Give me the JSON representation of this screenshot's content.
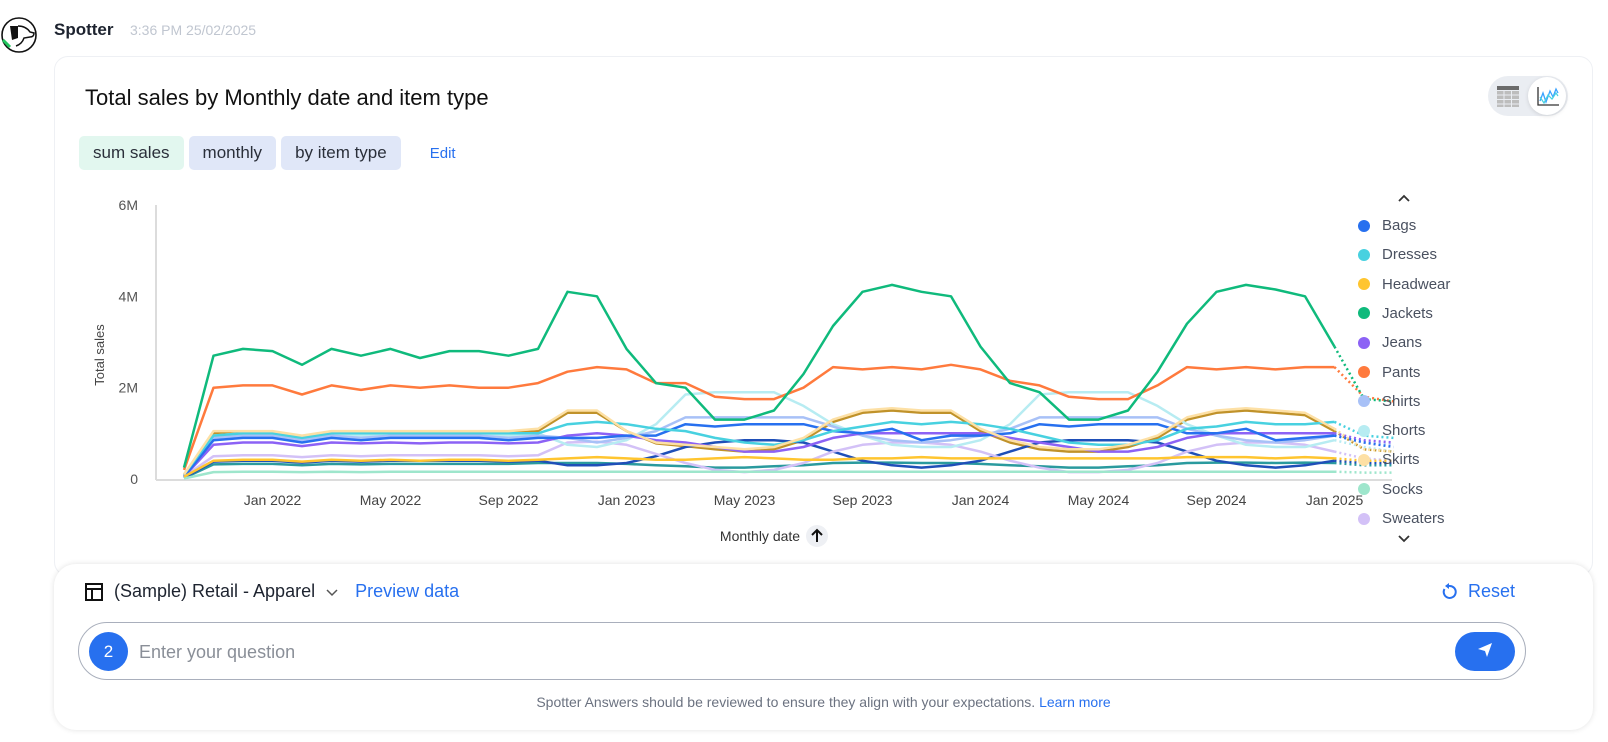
{
  "header": {
    "sender": "Spotter",
    "timestamp": "3:36 PM 25/02/2025",
    "avatar_icon": "spotter-dog-logo-icon"
  },
  "answer": {
    "title": "Total sales by Monthly date and item type",
    "chips": [
      {
        "label": "sum sales",
        "color": "#e2f7ef"
      },
      {
        "label": "monthly",
        "color": "#e0e7f8"
      },
      {
        "label": "by item type",
        "color": "#e0e7f8"
      }
    ],
    "edit_label": "Edit",
    "view_toggle": {
      "options": [
        "table-view-icon",
        "chart-view-icon"
      ],
      "selected": "chart-view-icon"
    },
    "legend_scroll_up_icon": "chevron-up-icon",
    "legend_scroll_down_icon": "chevron-down-icon",
    "sort_icon": "arrow-up-icon"
  },
  "chart_data": {
    "type": "line",
    "title": "Total sales by Monthly date and item type",
    "xlabel": "Monthly date",
    "ylabel": "Total sales",
    "ylim": [
      0,
      6000000
    ],
    "yticks": [
      "0",
      "2M",
      "4M",
      "6M"
    ],
    "ytick_values": [
      0,
      2000000,
      4000000,
      6000000
    ],
    "xticks": [
      "Jan 2022",
      "May 2022",
      "Sep 2022",
      "Jan 2023",
      "May 2023",
      "Sep 2023",
      "Jan 2024",
      "May 2024",
      "Sep 2024",
      "Jan 2025"
    ],
    "xtick_index": [
      3,
      7,
      11,
      15,
      19,
      23,
      27,
      31,
      35,
      39
    ],
    "x": [
      "Oct 2021",
      "Nov 2021",
      "Dec 2021",
      "Jan 2022",
      "Feb 2022",
      "Mar 2022",
      "Apr 2022",
      "May 2022",
      "Jun 2022",
      "Jul 2022",
      "Aug 2022",
      "Sep 2022",
      "Oct 2022",
      "Nov 2022",
      "Dec 2022",
      "Jan 2023",
      "Feb 2023",
      "Mar 2023",
      "Apr 2023",
      "May 2023",
      "Jun 2023",
      "Jul 2023",
      "Aug 2023",
      "Sep 2023",
      "Oct 2023",
      "Nov 2023",
      "Dec 2023",
      "Jan 2024",
      "Feb 2024",
      "Mar 2024",
      "Apr 2024",
      "May 2024",
      "Jun 2024",
      "Jul 2024",
      "Aug 2024",
      "Sep 2024",
      "Oct 2024",
      "Nov 2024",
      "Dec 2024",
      "Jan 2025",
      "Feb 2025",
      "Mar 2025"
    ],
    "partial_from_index": 40,
    "legend_position": "right",
    "grid": false,
    "series": [
      {
        "name": "Jackets",
        "color": "#0fba7c",
        "in_legend": true,
        "values": [
          0.25,
          2.7,
          2.85,
          2.8,
          2.5,
          2.85,
          2.7,
          2.85,
          2.65,
          2.8,
          2.8,
          2.7,
          2.85,
          4.1,
          4.0,
          2.85,
          2.1,
          2.0,
          1.3,
          1.3,
          1.5,
          2.3,
          3.35,
          4.1,
          4.25,
          4.1,
          4.0,
          2.9,
          2.1,
          1.9,
          1.3,
          1.3,
          1.5,
          2.35,
          3.4,
          4.1,
          4.25,
          4.15,
          4.0,
          2.9,
          1.75,
          1.7
        ]
      },
      {
        "name": "Pants",
        "color": "#ff7a3d",
        "in_legend": true,
        "values": [
          0.2,
          2.0,
          2.05,
          2.05,
          1.85,
          2.05,
          1.95,
          2.05,
          2.0,
          2.05,
          2.0,
          2.0,
          2.1,
          2.35,
          2.45,
          2.4,
          2.1,
          2.1,
          1.8,
          1.75,
          1.75,
          2.0,
          2.45,
          2.4,
          2.45,
          2.4,
          2.5,
          2.4,
          2.15,
          2.05,
          1.8,
          1.75,
          1.75,
          2.05,
          2.45,
          2.4,
          2.45,
          2.4,
          2.45,
          2.45,
          1.8,
          1.7
        ]
      },
      {
        "name": "Skirts",
        "color": "#fde0a5",
        "in_legend": true,
        "values": [
          0.1,
          1.05,
          1.05,
          1.05,
          0.95,
          1.05,
          1.05,
          1.05,
          1.05,
          1.05,
          1.05,
          1.05,
          1.1,
          1.5,
          1.5,
          1.05,
          0.8,
          0.75,
          0.7,
          0.65,
          0.7,
          0.9,
          1.3,
          1.5,
          1.55,
          1.5,
          1.5,
          1.1,
          0.85,
          0.7,
          0.65,
          0.65,
          0.75,
          0.95,
          1.35,
          1.5,
          1.55,
          1.5,
          1.45,
          1.1,
          0.65,
          0.6
        ]
      },
      {
        "name": "Headwear",
        "color": "#ffc52f",
        "in_legend": true,
        "values": [
          0.05,
          0.4,
          0.42,
          0.42,
          0.38,
          0.42,
          0.4,
          0.42,
          0.4,
          0.42,
          0.42,
          0.4,
          0.42,
          0.45,
          0.48,
          0.45,
          0.42,
          0.42,
          0.45,
          0.48,
          0.45,
          0.42,
          0.42,
          0.45,
          0.45,
          0.48,
          0.45,
          0.45,
          0.45,
          0.45,
          0.45,
          0.45,
          0.45,
          0.45,
          0.48,
          0.48,
          0.48,
          0.45,
          0.48,
          0.45,
          0.4,
          0.4
        ]
      },
      {
        "name": "Dresses",
        "color": "#48d1e0",
        "in_legend": true,
        "values": [
          0.1,
          0.95,
          1.0,
          1.0,
          0.9,
          1.0,
          1.0,
          1.0,
          1.0,
          1.0,
          1.0,
          1.0,
          1.0,
          1.2,
          1.25,
          1.2,
          1.1,
          1.05,
          0.9,
          0.8,
          0.75,
          0.85,
          1.05,
          1.15,
          1.25,
          1.2,
          1.25,
          1.2,
          1.1,
          0.95,
          0.8,
          0.75,
          0.75,
          0.85,
          1.1,
          1.15,
          1.25,
          1.2,
          1.2,
          1.25,
          0.95,
          0.9
        ]
      },
      {
        "name": "Bags",
        "color": "#2770ef",
        "in_legend": true,
        "values": [
          0.05,
          0.85,
          0.9,
          0.9,
          0.8,
          0.9,
          0.85,
          0.9,
          0.9,
          0.9,
          0.9,
          0.85,
          0.9,
          0.9,
          0.9,
          0.95,
          0.95,
          1.2,
          1.15,
          1.2,
          1.2,
          1.2,
          1.05,
          1.0,
          1.1,
          0.85,
          0.95,
          0.95,
          1.0,
          1.2,
          1.15,
          1.2,
          1.2,
          1.2,
          1.0,
          1.0,
          1.1,
          0.85,
          0.9,
          0.95,
          0.8,
          0.7
        ]
      },
      {
        "name": "Jeans",
        "color": "#8c62f5",
        "in_legend": true,
        "values": [
          0.05,
          0.75,
          0.8,
          0.8,
          0.72,
          0.8,
          0.78,
          0.8,
          0.78,
          0.8,
          0.8,
          0.78,
          0.8,
          0.95,
          1.0,
          0.95,
          0.85,
          0.8,
          0.7,
          0.6,
          0.6,
          0.7,
          0.9,
          1.0,
          1.0,
          1.0,
          1.0,
          1.0,
          0.9,
          0.8,
          0.7,
          0.6,
          0.6,
          0.7,
          0.9,
          1.0,
          1.0,
          1.0,
          1.0,
          1.0,
          0.85,
          0.8
        ]
      },
      {
        "name": "Shirts",
        "color": "#a8c1f7",
        "in_legend": true,
        "values": [
          0.08,
          0.9,
          0.95,
          0.95,
          0.85,
          0.95,
          0.9,
          0.95,
          0.95,
          0.95,
          0.95,
          0.9,
          0.95,
          0.9,
          0.8,
          0.9,
          1.05,
          1.35,
          1.35,
          1.35,
          1.35,
          1.35,
          1.15,
          0.95,
          0.85,
          0.8,
          0.85,
          0.95,
          1.1,
          1.35,
          1.35,
          1.35,
          1.35,
          1.35,
          1.1,
          0.95,
          0.85,
          0.8,
          0.85,
          0.95,
          0.8,
          0.75
        ]
      },
      {
        "name": "Shorts",
        "color": "#b7ecf2",
        "in_legend": true,
        "values": [
          0.08,
          0.95,
          1.0,
          1.0,
          0.9,
          1.0,
          0.95,
          1.0,
          1.0,
          1.0,
          1.0,
          0.95,
          1.0,
          0.75,
          0.7,
          0.85,
          1.2,
          1.85,
          1.9,
          1.9,
          1.9,
          1.6,
          1.2,
          0.95,
          0.75,
          0.7,
          0.7,
          0.85,
          1.2,
          1.85,
          1.9,
          1.9,
          1.9,
          1.6,
          1.2,
          0.95,
          0.75,
          0.7,
          0.7,
          0.85,
          0.7,
          0.6
        ]
      },
      {
        "name": "Socks",
        "color": "#9ee6cc",
        "in_legend": true,
        "values": [
          0.01,
          0.15,
          0.16,
          0.16,
          0.15,
          0.16,
          0.15,
          0.16,
          0.16,
          0.16,
          0.16,
          0.16,
          0.16,
          0.16,
          0.16,
          0.16,
          0.16,
          0.16,
          0.16,
          0.16,
          0.16,
          0.16,
          0.16,
          0.16,
          0.16,
          0.16,
          0.16,
          0.16,
          0.16,
          0.16,
          0.16,
          0.16,
          0.16,
          0.16,
          0.16,
          0.16,
          0.16,
          0.16,
          0.16,
          0.16,
          0.14,
          0.14
        ]
      },
      {
        "name": "Sweaters",
        "color": "#d3c1f7",
        "in_legend": true,
        "values": [
          0.05,
          0.5,
          0.52,
          0.52,
          0.48,
          0.52,
          0.5,
          0.52,
          0.52,
          0.52,
          0.52,
          0.5,
          0.52,
          0.8,
          0.82,
          0.75,
          0.55,
          0.35,
          0.2,
          0.15,
          0.2,
          0.35,
          0.6,
          0.75,
          0.8,
          0.8,
          0.75,
          0.6,
          0.4,
          0.25,
          0.15,
          0.15,
          0.2,
          0.35,
          0.6,
          0.75,
          0.8,
          0.8,
          0.75,
          0.6,
          0.45,
          0.4
        ]
      },
      {
        "name": "Other (navy)",
        "color": "#1f4fb8",
        "in_legend": false,
        "values": [
          0.03,
          0.38,
          0.4,
          0.4,
          0.36,
          0.4,
          0.38,
          0.4,
          0.4,
          0.4,
          0.4,
          0.38,
          0.4,
          0.3,
          0.3,
          0.35,
          0.5,
          0.7,
          0.8,
          0.85,
          0.85,
          0.8,
          0.6,
          0.4,
          0.3,
          0.25,
          0.3,
          0.4,
          0.6,
          0.8,
          0.85,
          0.85,
          0.85,
          0.8,
          0.6,
          0.4,
          0.3,
          0.25,
          0.3,
          0.4,
          0.35,
          0.35
        ]
      },
      {
        "name": "Other (teal)",
        "color": "#2a9a9e",
        "in_legend": false,
        "values": [
          0.02,
          0.32,
          0.33,
          0.33,
          0.3,
          0.33,
          0.32,
          0.33,
          0.33,
          0.33,
          0.33,
          0.33,
          0.35,
          0.35,
          0.35,
          0.33,
          0.3,
          0.28,
          0.25,
          0.25,
          0.28,
          0.3,
          0.35,
          0.36,
          0.36,
          0.35,
          0.35,
          0.33,
          0.3,
          0.28,
          0.25,
          0.25,
          0.28,
          0.3,
          0.35,
          0.36,
          0.36,
          0.35,
          0.36,
          0.35,
          0.3,
          0.3
        ]
      },
      {
        "name": "Other (gold)",
        "color": "#c0922a",
        "in_legend": false,
        "values": [
          0.08,
          1.0,
          1.02,
          1.02,
          0.92,
          1.02,
          1.02,
          1.02,
          1.02,
          1.02,
          1.02,
          1.0,
          1.05,
          1.45,
          1.45,
          1.05,
          0.78,
          0.72,
          0.65,
          0.6,
          0.65,
          0.85,
          1.25,
          1.45,
          1.5,
          1.45,
          1.45,
          1.05,
          0.8,
          0.65,
          0.6,
          0.6,
          0.7,
          0.9,
          1.3,
          1.45,
          1.5,
          1.45,
          1.4,
          1.05,
          0.65,
          0.6
        ]
      }
    ]
  },
  "composer": {
    "datasource_icon": "table-icon",
    "datasource": "(Sample) Retail - Apparel",
    "datasource_chevron": "chevron-down-icon",
    "preview_label": "Preview data",
    "reset_label": "Reset",
    "reset_icon": "reset-icon",
    "badge_count": "2",
    "input_placeholder": "Enter your question",
    "input_value": "",
    "send_icon": "send-icon",
    "disclaimer": "Spotter Answers should be reviewed to ensure they align with your expectations.",
    "learn_more_label": "Learn more"
  }
}
